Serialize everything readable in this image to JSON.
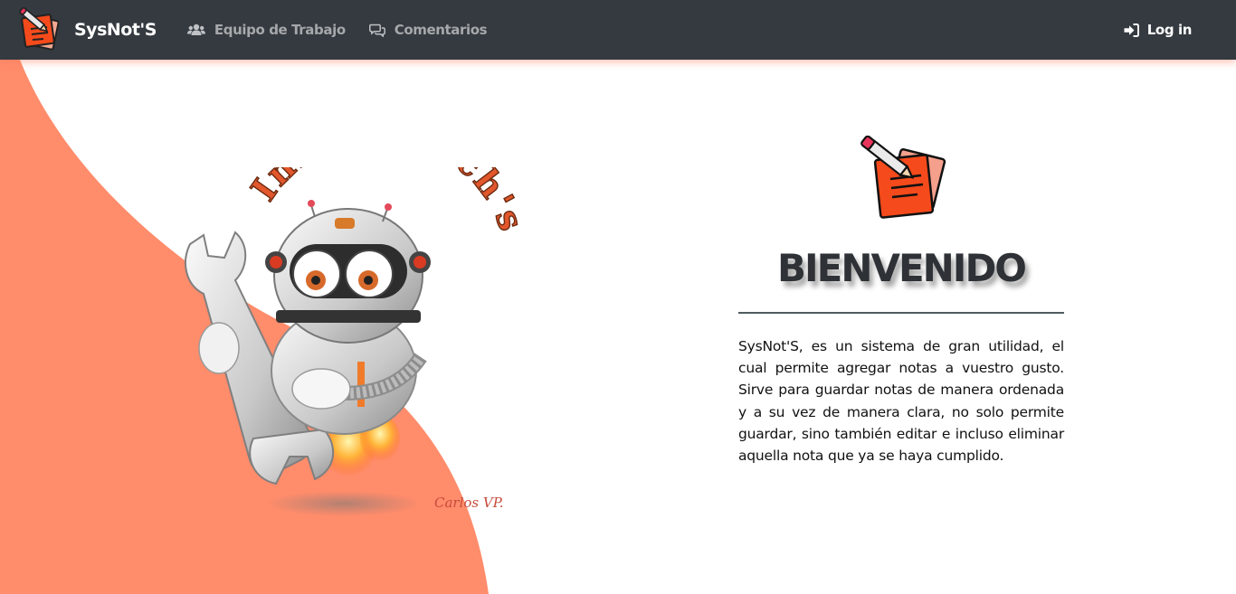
{
  "navbar": {
    "brand": "SysNot'S",
    "links": [
      {
        "label": "Equipo de Trabajo",
        "icon": "users-icon"
      },
      {
        "label": "Comentarios",
        "icon": "comments-icon"
      }
    ],
    "login": {
      "label": "Log in",
      "icon": "sign-in-icon"
    }
  },
  "hero": {
    "logo_text": "Innova Tech's",
    "signature": "Carlos VP."
  },
  "welcome": {
    "title": "BIENVENIDO",
    "description": "SysNot'S, es un sistema de gran utilidad, el cual permite agregar notas a vuestro gusto. Sirve para guardar notas de manera ordenada y a su vez de manera clara, no solo permite guardar, sino también editar e incluso eliminar aquella nota que ya se haya cumplido."
  },
  "colors": {
    "navbar_bg": "#343a40",
    "accent": "#ff8c6b",
    "nav_link": "#a6a8ab",
    "title": "#2e3236"
  }
}
